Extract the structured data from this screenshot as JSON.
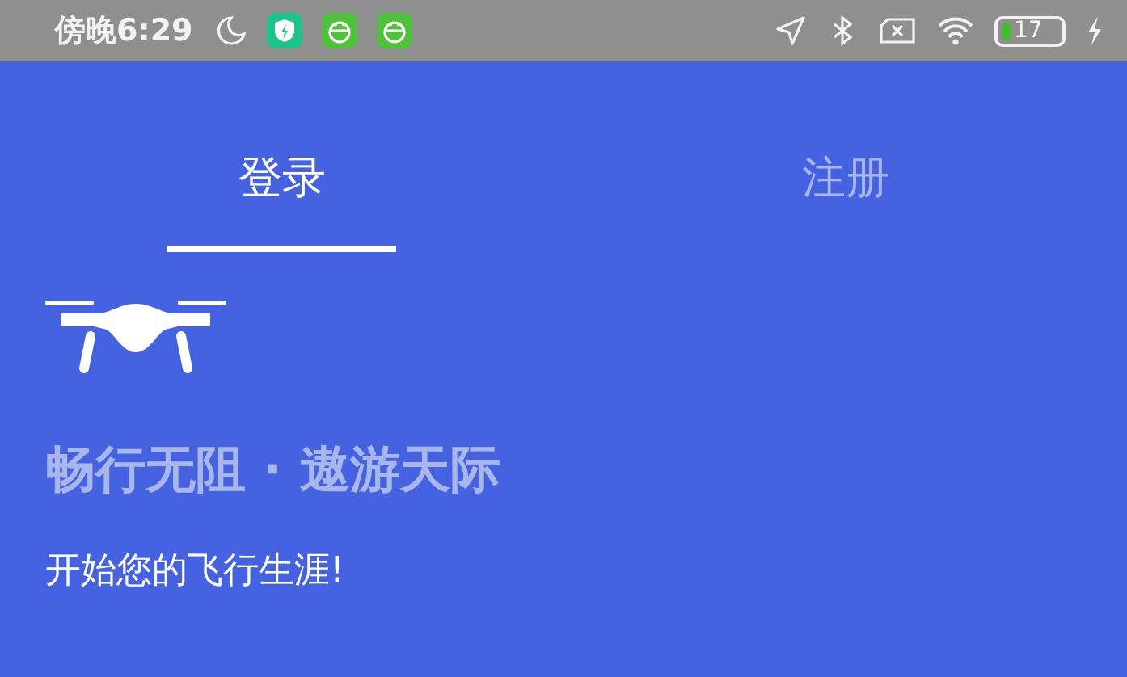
{
  "status_bar": {
    "time": "傍晚6:29",
    "battery": "17"
  },
  "tabs": [
    {
      "label": "登录",
      "selected": true
    },
    {
      "label": "注册",
      "selected": false
    }
  ],
  "headline": "畅行无阻 · 遨游天际",
  "subtitle": "开始您的飞行生涯!"
}
